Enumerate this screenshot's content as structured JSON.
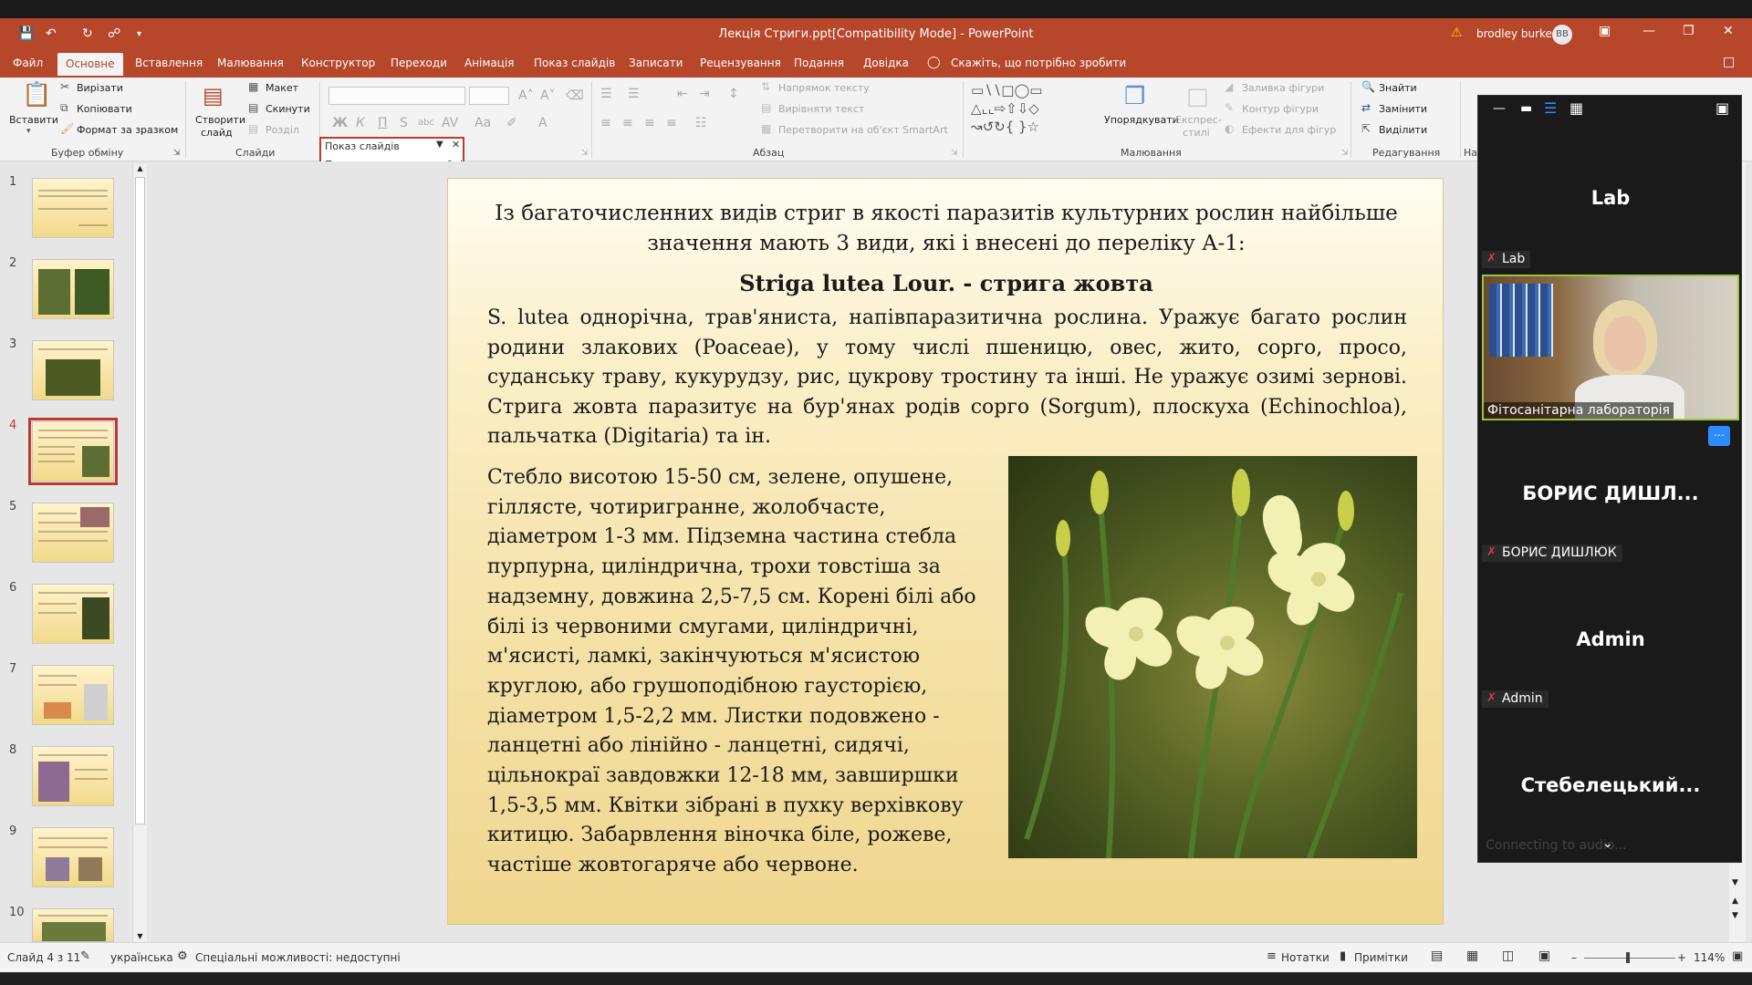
{
  "window": {
    "title": "Лекція Стриги.ppt[Compatibility Mode]  -  PowerPoint",
    "user_name": "brodley burke",
    "user_initials": "BB"
  },
  "tabs": [
    "Файл",
    "Основне",
    "Вставлення",
    "Малювання",
    "Конструктор",
    "Переходи",
    "Анімація",
    "Показ слайдів",
    "Записати",
    "Рецензування",
    "Подання",
    "Довідка"
  ],
  "search_hint": "Скажіть, що потрібно зробити",
  "ribbon": {
    "clipboard": {
      "paste": "Вставити",
      "cut": "Вирізати",
      "copy": "Копіювати",
      "format_painter": "Формат за зразком",
      "group": "Буфер обміну"
    },
    "slides": {
      "new_slide": "Створити",
      "new_slide2": "слайд",
      "layout": "Макет",
      "reset": "Скинути",
      "section": "Розділ",
      "group": "Слайди"
    },
    "paragraph": {
      "group": "Абзац",
      "text_direction": "Напрямок тексту",
      "align_text": "Вирівняти текст",
      "smartart": "Перетворити на об'єкт SmartArt"
    },
    "drawing": {
      "arrange": "Упорядкувати",
      "quick_styles": "Експрес-",
      "quick_styles2": "стилі",
      "shape_fill": "Заливка фігури",
      "shape_outline": "Контур фігури",
      "shape_effects": "Ефекти для фігур",
      "group": "Малювання"
    },
    "editing": {
      "find": "Знайти",
      "replace": "Замінити",
      "select": "Виділити",
      "group": "Редагування"
    },
    "partial_group": "На"
  },
  "slideshow_popup": {
    "title": "Показ слайдів",
    "resume": "Продовжити показ слайдів"
  },
  "slide_numbers": [
    "1",
    "2",
    "3",
    "4",
    "5",
    "6",
    "7",
    "8",
    "9",
    "10"
  ],
  "slide": {
    "intro": "Із багаточисленних видів стриг в якості паразитів культурних рослин найбільше значення мають 3 види, які і внесені до переліку А-1:",
    "heading": "Striga lutea Lour. - стрига жовта",
    "para1": "S. lutea однорічна, трав'яниста, напівпаразитична рослина. Уражує багато рослин родини злакових (Poaceae), у тому числі пшеницю, овес, жито, сорго, просо, суданську траву, кукурудзу, рис, цукрову тростину та інші. Не уражує озимі зернові. Стрига жовта паразитує на бур'янах родів сорго (Sorgum), плоскуха (Echinochloa), пальчатка (Digitaria) та ін.",
    "para2": "Стебло висотою 15-50 см, зелене, опушене, гіллясте, чотиригранне, жолобчасте, діаметром 1-3 мм. Підземна частина стебла пурпурна, циліндрична, трохи товстіша за надземну, довжина 2,5-7,5 см. Корені білі або білі із червоними смугами, циліндричні, м'ясисті, ламкі, закінчуються м'ясистою круглою, або грушоподібною гаусторією, діаметром 1,5-2,2 мм. Листки подовжено - ланцетні або лінійно - ланцетні, сидячі, цільнокраї завдовжки 12-18 мм, завширшки 1,5-3,5 мм. Квітки зібрані в пухку верхівкову китицю. Забарвлення віночка біле, рожеве, частіше жовтогаряче або червоне."
  },
  "zoom": {
    "p1_big": "Lab",
    "p1_label": "Lab",
    "video_label": "Фітосанітарна лабораторія",
    "p2_big": "БОРИС  ДИШЛ...",
    "p2_label": "БОРИС ДИШЛЮК",
    "p3_big": "Admin",
    "p3_label": "Admin",
    "p4_big": "Стебелецький...",
    "connecting": "Connecting to audio..."
  },
  "status": {
    "slide_of": "Слайд 4 з 11",
    "language": "українська",
    "accessibility": "Спеціальні можливості: недоступні",
    "notes": "Нотатки",
    "comments": "Примітки",
    "zoom": "114%"
  },
  "colors": {
    "accent": "#b7472a",
    "selected_outline": "#c0392b",
    "zoom_panel": "#1a1a1a"
  }
}
